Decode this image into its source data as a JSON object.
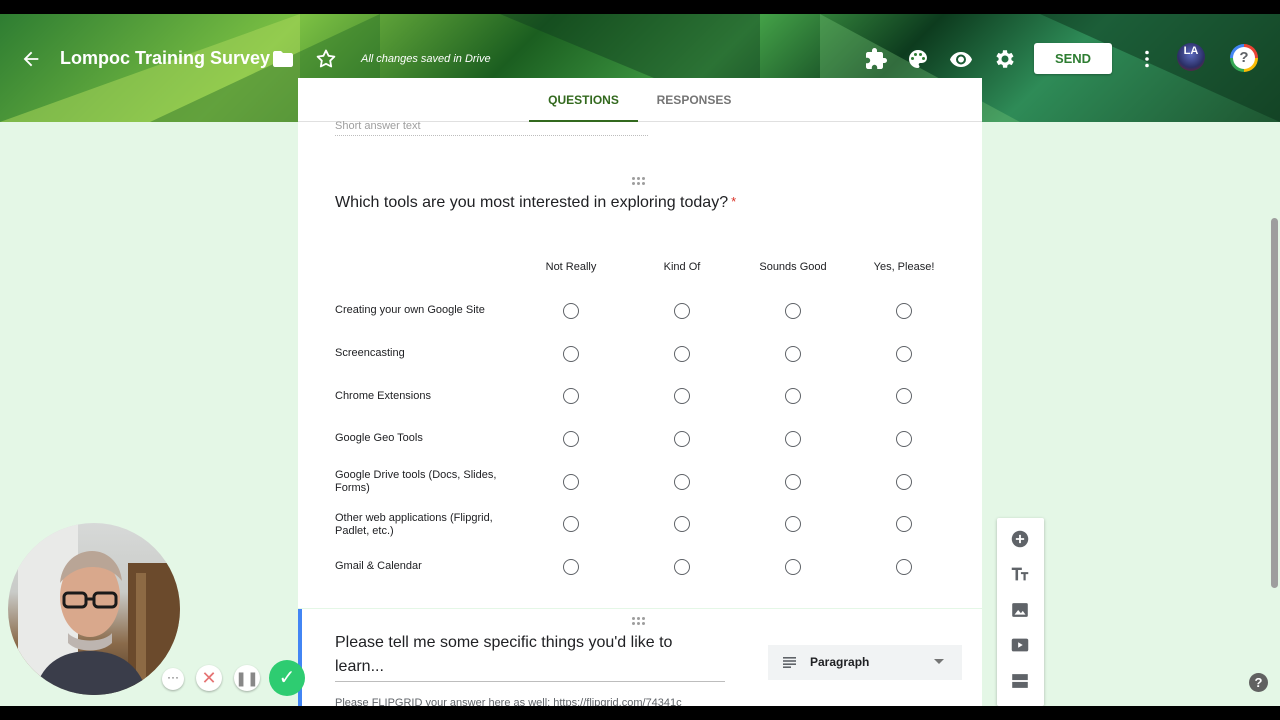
{
  "header": {
    "title": "Lompoc Training Survey",
    "saved_status": "All changes saved in Drive",
    "send_label": "SEND",
    "help_label": "?",
    "avatar_initials": "LA",
    "icons": [
      "back-arrow-icon",
      "folder-icon",
      "star-icon",
      "addons-icon",
      "palette-icon",
      "preview-icon",
      "settings-icon",
      "more-vert-icon"
    ]
  },
  "tabs": {
    "questions": "QUESTIONS",
    "responses": "RESPONSES"
  },
  "prev_question": {
    "short_answer_placeholder": "Short answer text"
  },
  "question": {
    "title": "Which tools are you most interested in exploring today?",
    "required_mark": "*",
    "columns": [
      "Not Really",
      "Kind Of",
      "Sounds Good",
      "Yes, Please!"
    ],
    "rows": [
      "Creating your own Google Site",
      "Screencasting",
      "Chrome Extensions",
      "Google Geo Tools",
      "Google Drive tools (Docs, Slides, Forms)",
      "Other web applications (Flipgrid, Padlet, etc.)",
      "Gmail & Calendar"
    ]
  },
  "question2": {
    "title": "Please tell me some specific things you'd like to learn...",
    "type": "Paragraph",
    "description": "Please FLIPGRID your answer here as well:  https://flipgrid.com/74341c"
  },
  "toolbar": {
    "tools": [
      "add-question-icon",
      "add-title-icon",
      "add-image-icon",
      "add-video-icon",
      "add-section-icon"
    ]
  },
  "recorder": {
    "more_label": "···",
    "cancel_label": "✕",
    "pause_label": "❚❚",
    "done_label": "✓"
  },
  "help_bottom": "?",
  "colors": {
    "accent": "#33691e",
    "required": "#d93025",
    "active_card_border": "#4285f4",
    "page_bg": "#e4f7e6"
  }
}
